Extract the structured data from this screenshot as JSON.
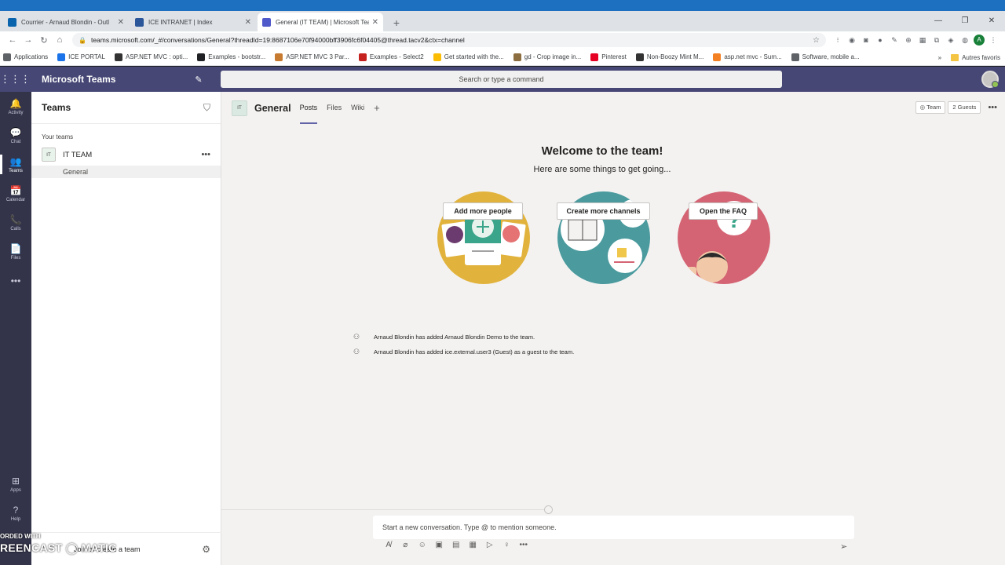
{
  "browser": {
    "tabs": [
      {
        "title": "Courrier - Arnaud Blondin - Outl",
        "favicon_color": "#0a64ad",
        "active": false
      },
      {
        "title": "ICE INTRANET | Index",
        "favicon_color": "#2b579a",
        "active": false
      },
      {
        "title": "General (IT TEAM) | Microsoft Tea",
        "favicon_color": "#5059c9",
        "active": true
      }
    ],
    "url": "teams.microsoft.com/_#/conversations/General?threadId=19:8687106e70f94000bff3906fc6f04405@thread.tacv2&ctx=channel",
    "bookmarks": [
      {
        "label": "Applications",
        "color": "#5f6368"
      },
      {
        "label": "ICE PORTAL",
        "color": "#1a73e8"
      },
      {
        "label": "ASP.NET MVC : opti...",
        "color": "#333333"
      },
      {
        "label": "Examples - bootstr...",
        "color": "#202124"
      },
      {
        "label": "ASP.NET MVC 3 Par...",
        "color": "#c77b30"
      },
      {
        "label": "Examples - Select2",
        "color": "#c5221f"
      },
      {
        "label": "Get started with the...",
        "color": "#fbbc04"
      },
      {
        "label": "gd - Crop image in...",
        "color": "#8c6d3f"
      },
      {
        "label": "Pinterest",
        "color": "#e60023"
      },
      {
        "label": "Non-Boozy Mint M...",
        "color": "#333333"
      },
      {
        "label": "asp.net mvc - Sum...",
        "color": "#f48024"
      },
      {
        "label": "Software, mobile a...",
        "color": "#5f6368"
      }
    ],
    "bookmarks_more": "»",
    "other_bookmarks": "Autres favoris"
  },
  "teams": {
    "app_title": "Microsoft Teams",
    "search_placeholder": "Search or type a command",
    "appbar": [
      {
        "icon": "🔔",
        "label": "Activity",
        "active": false
      },
      {
        "icon": "💬",
        "label": "Chat",
        "active": false
      },
      {
        "icon": "👥",
        "label": "Teams",
        "active": true
      },
      {
        "icon": "📅",
        "label": "Calendar",
        "active": false
      },
      {
        "icon": "📞",
        "label": "Calls",
        "active": false
      },
      {
        "icon": "📄",
        "label": "Files",
        "active": false
      }
    ],
    "appbar_more": "•••",
    "appbar_bottom": [
      {
        "icon": "⊞",
        "label": "Apps"
      },
      {
        "icon": "?",
        "label": "Help"
      }
    ],
    "panel": {
      "title": "Teams",
      "section_label": "Your teams",
      "team_initials": "IT",
      "team_name": "IT TEAM",
      "channel_name": "General",
      "join_label": "Join or create a team"
    },
    "channel": {
      "initials": "IT",
      "name": "General",
      "tabs": [
        "Posts",
        "Files",
        "Wiki"
      ],
      "active_tab": "Posts",
      "team_pill": "Team",
      "guests_pill": "2 Guests"
    },
    "welcome": {
      "title": "Welcome to the team!",
      "subtitle": "Here are some things to get going...",
      "cards": [
        {
          "button": "Add more people",
          "color": "#e2b33c"
        },
        {
          "button": "Create more channels",
          "color": "#4a9a9e"
        },
        {
          "button": "Open the FAQ",
          "color": "#d46473"
        }
      ]
    },
    "activity": [
      "Arnaud Blondin has added Arnaud Blondin Demo to the team.",
      "Arnaud Blondin has added ice.external.user3 (Guest) as a guest to the team."
    ],
    "compose_placeholder": "Start a new conversation. Type @ to mention someone."
  },
  "watermark": {
    "line1": "ORDED WITH",
    "line2": "REENCAST ◯ MATIC"
  }
}
